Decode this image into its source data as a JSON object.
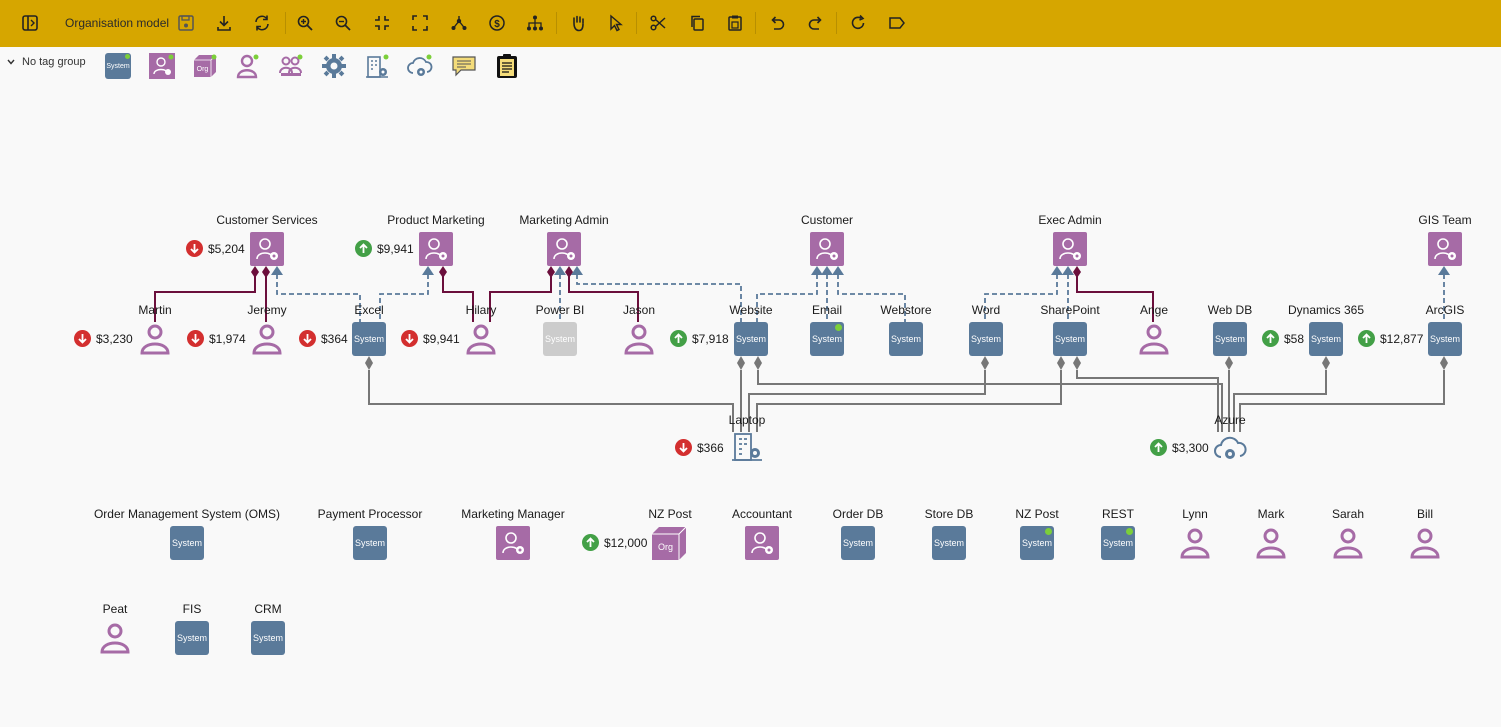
{
  "toolbar": {
    "title": "Organisation model",
    "buttons": [
      "toggle-sidebar",
      "save",
      "download",
      "sync",
      "zoom-in",
      "zoom-out",
      "fit-selection",
      "fit-all",
      "network",
      "currency",
      "hierarchy",
      "pan",
      "select",
      "cut",
      "copy",
      "paste",
      "undo",
      "redo",
      "refresh",
      "tag"
    ]
  },
  "palette": {
    "tag_group_label": "No tag group",
    "items": [
      "System",
      "Role",
      "Org",
      "Person",
      "Team",
      "Settings",
      "Building",
      "Cloud",
      "Comment",
      "Clipboard"
    ],
    "system_text": "System",
    "org_text": "Org"
  },
  "colors": {
    "toolbar": "#d6a600",
    "system": "#5a7a9a",
    "role": "#a66ba6",
    "person": "#a66ba6",
    "cost_down": "#d32f2f",
    "cost_up": "#43a047"
  },
  "nodes": {
    "customer_services": {
      "label": "Customer Services",
      "cost": "$5,204",
      "trend": "down"
    },
    "product_marketing": {
      "label": "Product Marketing",
      "cost": "$9,941",
      "trend": "up"
    },
    "marketing_admin": {
      "label": "Marketing Admin"
    },
    "customer": {
      "label": "Customer"
    },
    "exec_admin": {
      "label": "Exec Admin"
    },
    "gis_team": {
      "label": "GIS Team"
    },
    "martin": {
      "label": "Martin",
      "cost": "$3,230",
      "trend": "down"
    },
    "jeremy": {
      "label": "Jeremy",
      "cost": "$1,974",
      "trend": "down"
    },
    "excel": {
      "label": "Excel",
      "cost": "$364",
      "trend": "down"
    },
    "hilary": {
      "label": "Hilary",
      "cost": "$9,941",
      "trend": "down"
    },
    "power_bi": {
      "label": "Power BI"
    },
    "jason": {
      "label": "Jason"
    },
    "website": {
      "label": "Website",
      "cost": "$7,918",
      "trend": "up"
    },
    "email": {
      "label": "Email"
    },
    "webstore": {
      "label": "Webstore"
    },
    "word": {
      "label": "Word"
    },
    "sharepoint": {
      "label": "SharePoint"
    },
    "ange": {
      "label": "Ange"
    },
    "web_db": {
      "label": "Web DB"
    },
    "dynamics": {
      "label": "Dynamics 365",
      "cost": "$58",
      "trend": "up"
    },
    "arcgis": {
      "label": "ArcGIS",
      "cost": "$12,877",
      "trend": "up"
    },
    "laptop": {
      "label": "Laptop",
      "cost": "$366",
      "trend": "down"
    },
    "azure": {
      "label": "Azure",
      "cost": "$3,300",
      "trend": "up"
    },
    "oms": {
      "label": "Order Management System (OMS)"
    },
    "payment": {
      "label": "Payment Processor"
    },
    "marketing_manager": {
      "label": "Marketing Manager"
    },
    "nz_post_org": {
      "label": "NZ Post",
      "cost": "$12,000",
      "trend": "up"
    },
    "accountant": {
      "label": "Accountant"
    },
    "order_db": {
      "label": "Order DB"
    },
    "store_db": {
      "label": "Store DB"
    },
    "nz_post_sys": {
      "label": "NZ Post"
    },
    "rest": {
      "label": "REST"
    },
    "lynn": {
      "label": "Lynn"
    },
    "mark": {
      "label": "Mark"
    },
    "sarah": {
      "label": "Sarah"
    },
    "bill": {
      "label": "Bill"
    },
    "peat": {
      "label": "Peat"
    },
    "fis": {
      "label": "FIS"
    },
    "crm": {
      "label": "CRM"
    }
  }
}
